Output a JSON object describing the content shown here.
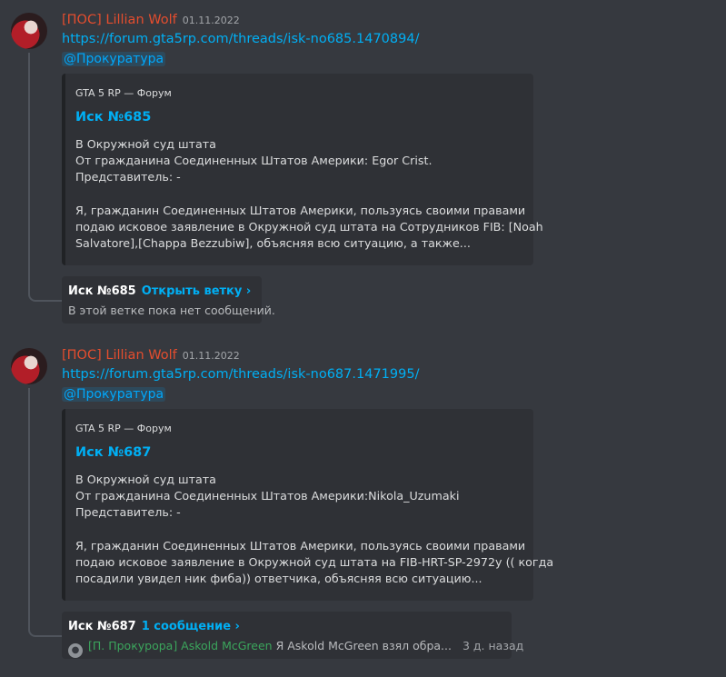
{
  "messages": [
    {
      "author": "[ПОС] Lillian Wolf",
      "timestamp": "01.11.2022",
      "link": "https://forum.gta5rp.com/threads/isk-no685.1470894/",
      "mention": "@Прокуратура",
      "embed": {
        "provider": "GTA 5 RP — Форум",
        "title": "Иск №685",
        "lines": [
          "В Окружной суд штата",
          "От гражданина Соединенных Штатов Америки: Egor Crist.",
          "Представитель: -",
          "",
          "Я, гражданин Соединенных Штатов Америки, пользуясь своими правами",
          "подаю исковое заявление в Окружной суд штата на Сотрудников FIB: [Noah",
          "Salvatore],[Chappa Bezzubiw], объясняя всю ситуацию, а также..."
        ]
      },
      "thread": {
        "name": "Иск №685",
        "action": "Открыть ветку ›",
        "subtitle": "В этой ветке пока нет сообщений."
      }
    },
    {
      "author": "[ПОС] Lillian Wolf",
      "timestamp": "01.11.2022",
      "link": "https://forum.gta5rp.com/threads/isk-no687.1471995/",
      "mention": "@Прокуратура",
      "embed": {
        "provider": "GTA 5 RP — Форум",
        "title": "Иск №687",
        "lines": [
          "В Окружной суд штата",
          "От гражданина Соединенных Штатов Америки:Nikola_Uzumaki",
          "Представитель: -",
          "",
          "Я, гражданин Соединенных Штатов Америки, пользуясь своими правами",
          "подаю исковое заявление в Окружной суд штата на FIB-HRT-SP-2972y (( когда",
          "посадили увидел ник фиба)) ответчика, объясняя всю ситуацию..."
        ]
      },
      "thread": {
        "name": "Иск №687",
        "action": "1 сообщение ›",
        "last_author": "[П. Прокурора] Askold McGreen",
        "last_text": "Я Askold McGreen взял обра...",
        "last_time": "3 д. назад"
      }
    }
  ]
}
